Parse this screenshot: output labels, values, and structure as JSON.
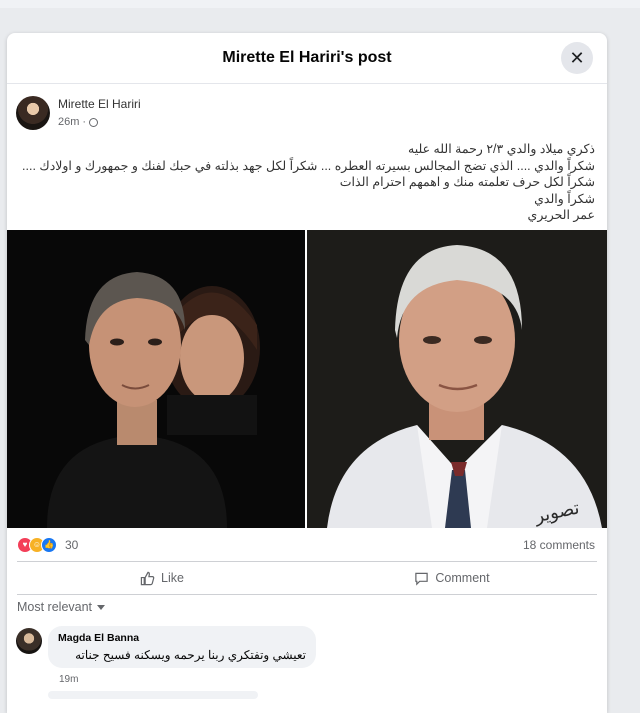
{
  "modal": {
    "title": "Mirette El Hariri's post",
    "close_icon": "close-icon"
  },
  "post": {
    "author": "Mirette El Hariri",
    "time": "26m",
    "privacy_icon": "globe-icon",
    "lines": [
      "ذكري ميلاد والدي ٢/٣ رحمة الله عليه",
      "شكراً والدي .... الذي تضج المجالس بسيرته العطره ... شكراً لكل جهد بذلته في حبك لفنك و جمهورك و اولادك ....",
      "شكراً لكل حرف تعلمته منك و اهمهم احترام الذات",
      "شكراً والدي",
      "عمر الحريري"
    ],
    "photo_watermark": "تصوير"
  },
  "stats": {
    "reactions_count": "30",
    "comments_count": "18 comments",
    "reaction_icons": [
      "love-icon",
      "care-icon",
      "like-icon"
    ]
  },
  "actions": {
    "like_label": "Like",
    "comment_label": "Comment"
  },
  "comments": {
    "sort_label": "Most relevant",
    "items": [
      {
        "name": "Magda El Banna",
        "text": "تعيشي وتفتكري ربنا يرحمه ويسكنه فسيح جناته",
        "time": "19m"
      }
    ]
  }
}
